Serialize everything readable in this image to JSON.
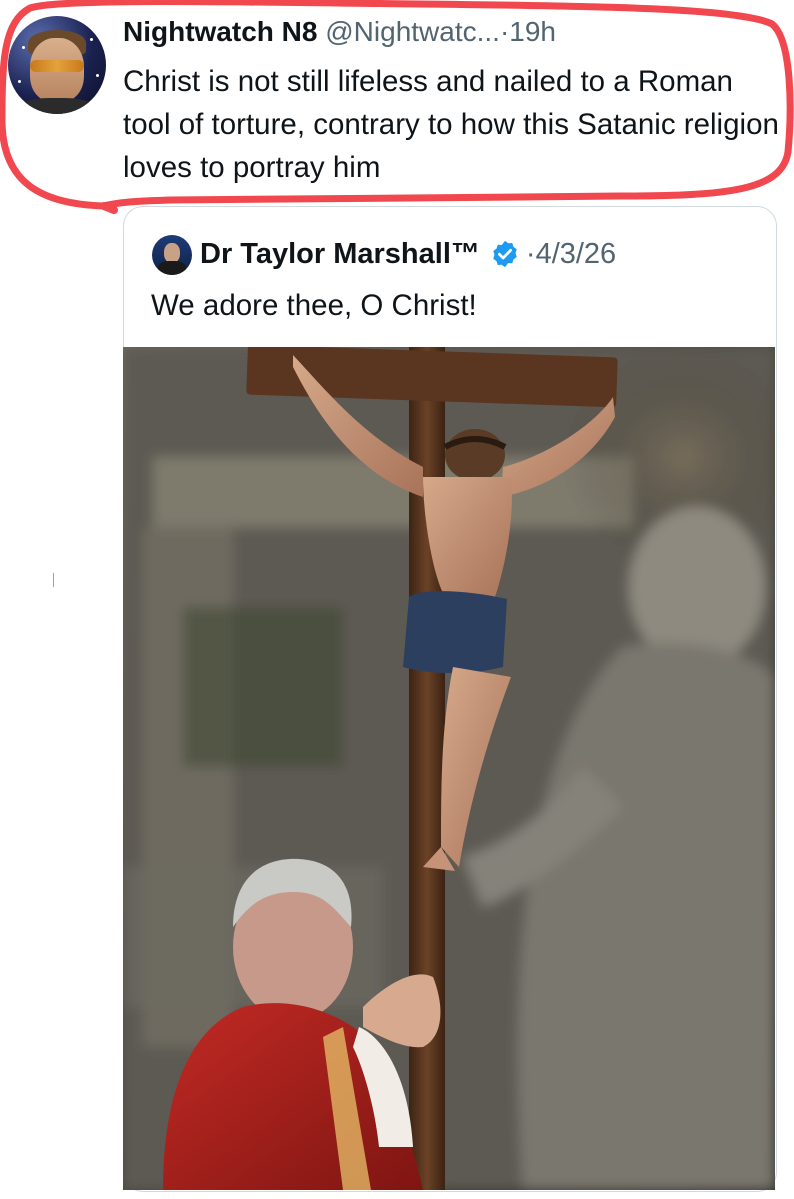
{
  "tweet": {
    "author_name": "Nightwatch N8",
    "author_handle": "@Nightwatc...",
    "separator": "·",
    "time": "19h",
    "text": "Christ is not still lifeless and nailed to a Roman tool of torture, contrary to how this Satanic religion loves to portray him",
    "highlight_color": "#f0484e"
  },
  "quoted_tweet": {
    "author_name": "Dr Taylor Marshall™",
    "verified_icon": "verified-badge-icon",
    "separator": "·",
    "date": "4/3/26",
    "text": "We adore thee, O Christ!",
    "verified_color": "#1d9bf0"
  },
  "photo": {
    "subject": "crucifix-photo"
  }
}
